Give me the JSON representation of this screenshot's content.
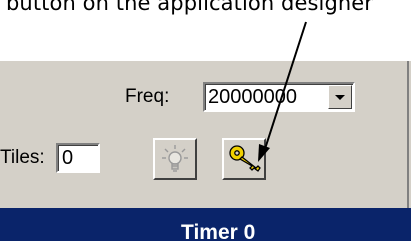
{
  "caption": "button on the application designer",
  "frequency": {
    "label": "Freq:",
    "value": "20000000"
  },
  "tiles": {
    "label": "Tiles:",
    "value": "0"
  },
  "toolbar": {
    "icons": [
      "lightbulb-icon",
      "key-icon"
    ]
  },
  "section_header": {
    "title": "Timer 0"
  },
  "colors": {
    "panel": "#d4d0c8",
    "header": "#0a246a",
    "key": "#e8c800"
  }
}
